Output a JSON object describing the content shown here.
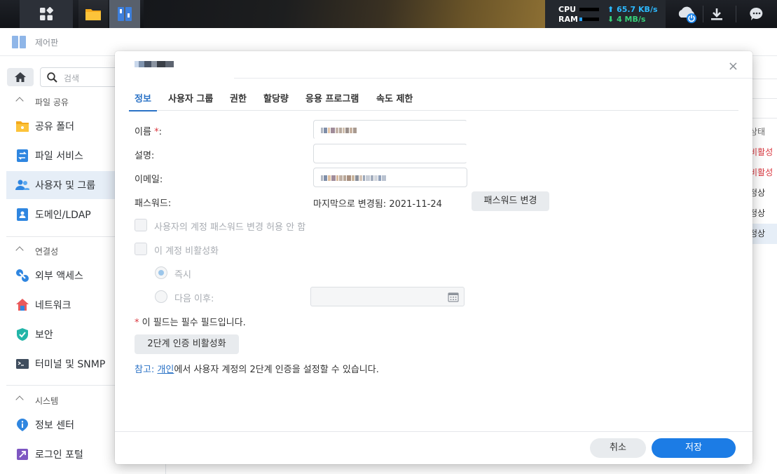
{
  "taskbar": {
    "cpu_label": "CPU",
    "ram_label": "RAM",
    "upload_rate": "65.7 KB/s",
    "download_rate": "4 MB/s"
  },
  "app": {
    "title": "제어판",
    "search_placeholder": "검색"
  },
  "sidebar": {
    "sections": [
      {
        "label": "파일 공유",
        "items": [
          "공유 폴더",
          "파일 서비스",
          "사용자 및 그룹",
          "도메인/LDAP"
        ]
      },
      {
        "label": "연결성",
        "items": [
          "외부 액세스",
          "네트워크",
          "보안",
          "터미널 및 SNMP"
        ]
      },
      {
        "label": "시스템",
        "items": [
          "정보 센터",
          "로그인 포털"
        ]
      }
    ]
  },
  "background_table": {
    "header": "상태",
    "cells": [
      "비활성",
      "비활성",
      "정상",
      "정상",
      "정상"
    ]
  },
  "dialog": {
    "close": "×",
    "tabs": [
      "정보",
      "사용자 그룹",
      "권한",
      "할당량",
      "응용 프로그램",
      "속도 제한"
    ],
    "fields": {
      "name_label": "이름",
      "name_required_mark": "*",
      "name_colon": ":",
      "desc_label": "설명:",
      "email_label": "이메일:",
      "password_label": "패스워드:",
      "password_changed_prefix": "마지막으로 변경됨:",
      "password_changed_date": "2021-11-24",
      "change_password_button": "패스워드 변경"
    },
    "options": {
      "disallow_pw_change": "사용자의 계정 패스워드 변경 허용 안 함",
      "disable_account": "이 계정 비활성화",
      "immediately": "즉시",
      "after": "다음 이후:"
    },
    "required_note_mark": "*",
    "required_note": " 이 필드는 필수 필드입니다.",
    "twofa_button": "2단계 인증 비활성화",
    "note": {
      "prefix": "참고:",
      "link": "개인",
      "suffix": "에서 사용자 계정의 2단계 인증을 설정할 수 있습니다."
    },
    "cancel_button": "취소",
    "save_button": "저장"
  },
  "colors": {
    "accent": "#1c7ce5",
    "link": "#2a72c6",
    "required": "#d9363e",
    "status_inactive": "#d9363e"
  }
}
